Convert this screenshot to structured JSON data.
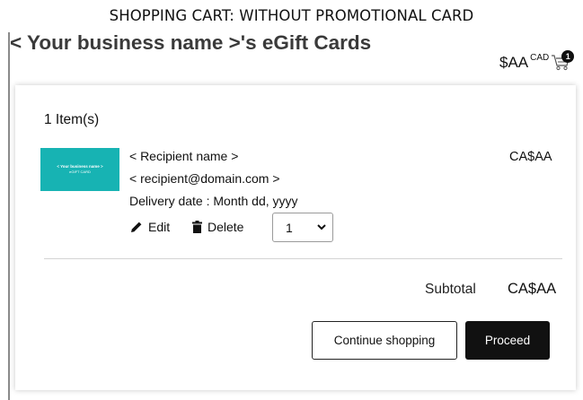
{
  "caption": "SHOPPING CART: WITHOUT PROMOTIONAL CARD",
  "header": {
    "store_title": "< Your business name >'s eGift Cards",
    "cart_amount": "$AA",
    "cart_currency": "CAD",
    "cart_badge_count": "1"
  },
  "cart": {
    "item_count_label": "1 Item(s)",
    "item": {
      "thumbnail_line1": "< Your business name >",
      "thumbnail_line2": "eGIFT CARD",
      "recipient_name": "< Recipient name >",
      "recipient_email": "< recipient@domain.com >",
      "delivery_date": "Delivery date : Month dd, yyyy",
      "price": "CA$AA",
      "edit_label": "Edit",
      "delete_label": "Delete",
      "quantity": "1"
    },
    "subtotal_label": "Subtotal",
    "subtotal_value": "CA$AA",
    "continue_label": "Continue shopping",
    "proceed_label": "Proceed"
  },
  "colors": {
    "thumbnail_bg": "#17b3b3",
    "primary_button": "#111111"
  },
  "icons": {
    "cart": "shopping-cart-icon",
    "edit": "pencil-icon",
    "delete": "trash-icon",
    "dropdown": "chevron-down-icon"
  }
}
